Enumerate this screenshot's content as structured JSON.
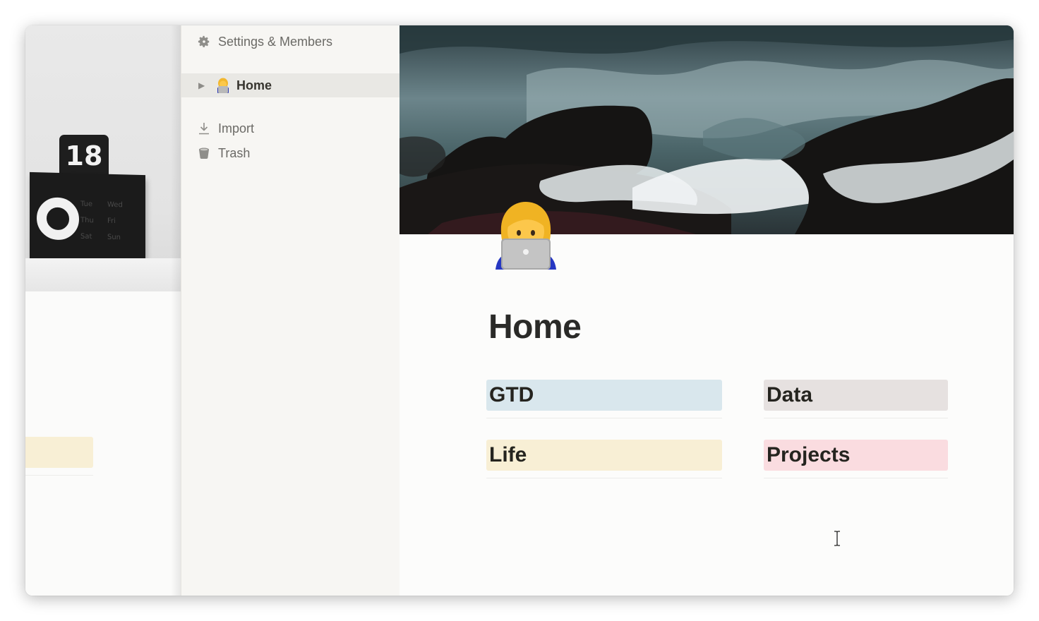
{
  "underlay": {
    "calendar_number": "18",
    "calendar_days": [
      "Tue",
      "Wed",
      "Thu",
      "Fri",
      "Sat",
      "Sun"
    ]
  },
  "sidebar": {
    "settings_label": "Settings & Members",
    "pages": [
      {
        "label": "Home",
        "icon": "woman-technologist-emoji",
        "selected": true
      }
    ],
    "import_label": "Import",
    "trash_label": "Trash"
  },
  "page": {
    "title": "Home",
    "icon": "woman-technologist-emoji",
    "blocks": [
      {
        "label": "GTD",
        "color": "#d9e7ed"
      },
      {
        "label": "Data",
        "color": "#e6e1e0"
      },
      {
        "label": "Life",
        "color": "#f8efd5"
      },
      {
        "label": "Projects",
        "color": "#fadce0"
      }
    ]
  },
  "colors": {
    "sidebar_bg": "#f7f6f3",
    "selected_bg": "#e9e8e4",
    "text": "#37352f"
  }
}
